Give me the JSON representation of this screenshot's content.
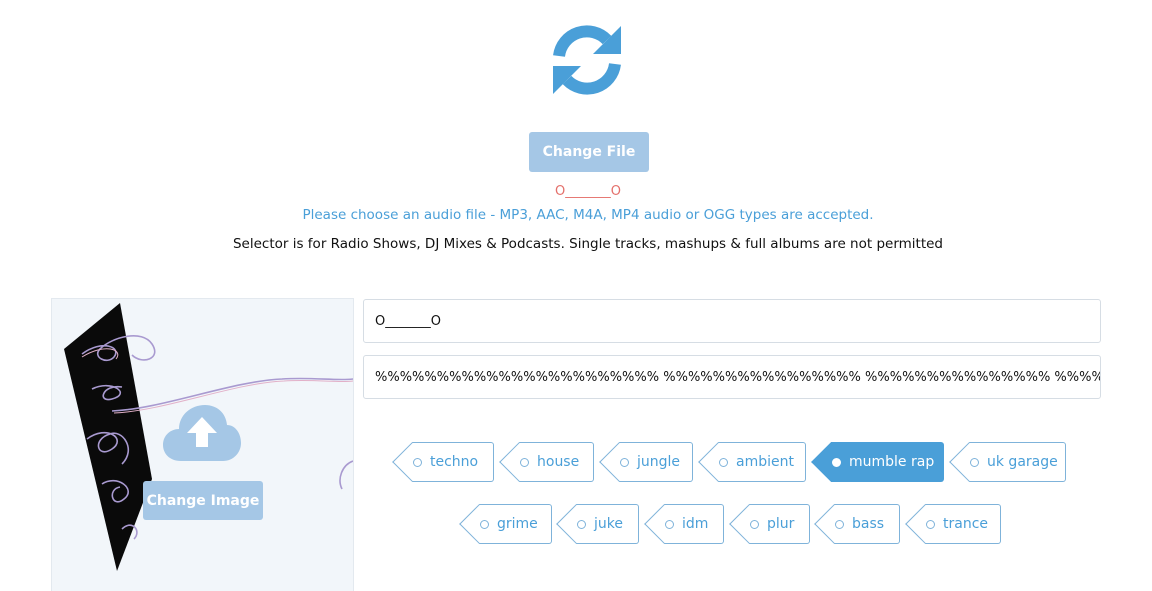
{
  "header": {
    "refresh_icon": "refresh-icon",
    "change_file_label": "Change File",
    "file_name": "O_______O",
    "hint": "Please choose an audio file - MP3, AAC, M4A, MP4 audio or OGG types are accepted.",
    "policy": "Selector is for Radio Shows, DJ Mixes & Podcasts. Single tracks, mashups & full albums are not permitted"
  },
  "image_panel": {
    "upload_icon": "cloud-upload-icon",
    "change_image_label": "Change Image"
  },
  "form": {
    "title_value": "O_______O",
    "tags_value": "%%%%%%%%%%%%%%%%%%%%%%% %%%%%%%%%%%%%%%% %%%%%%%%%%%%%%% %%%%%%%%%"
  },
  "genres": [
    {
      "label": "techno",
      "selected": false
    },
    {
      "label": "house",
      "selected": false
    },
    {
      "label": "jungle",
      "selected": false
    },
    {
      "label": "ambient",
      "selected": false
    },
    {
      "label": "mumble rap",
      "selected": true
    },
    {
      "label": "uk garage",
      "selected": false
    },
    {
      "label": "grime",
      "selected": false
    },
    {
      "label": "juke",
      "selected": false
    },
    {
      "label": "idm",
      "selected": false
    },
    {
      "label": "plur",
      "selected": false
    },
    {
      "label": "bass",
      "selected": false
    },
    {
      "label": "trance",
      "selected": false
    }
  ],
  "colors": {
    "accent": "#4a9fd8",
    "button_bg": "#a5c7e6",
    "filename": "#e4706b"
  }
}
